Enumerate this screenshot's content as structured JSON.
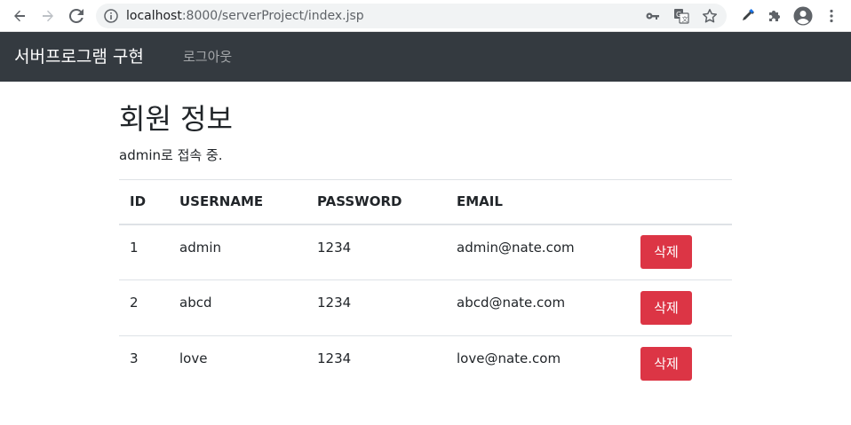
{
  "browser": {
    "url_host": "localhost",
    "url_rest": ":8000/serverProject/index.jsp"
  },
  "navbar": {
    "brand": "서버프로그램 구현",
    "logout": "로그아웃"
  },
  "main": {
    "title": "회원 정보",
    "status": "admin로 접속 중."
  },
  "table": {
    "headers": [
      "ID",
      "USERNAME",
      "PASSWORD",
      "EMAIL"
    ],
    "delete_label": "삭제",
    "rows": [
      {
        "id": "1",
        "username": "admin",
        "password": "1234",
        "email": "admin@nate.com"
      },
      {
        "id": "2",
        "username": "abcd",
        "password": "1234",
        "email": "abcd@nate.com"
      },
      {
        "id": "3",
        "username": "love",
        "password": "1234",
        "email": "love@nate.com"
      }
    ]
  },
  "colors": {
    "navbar_bg": "#343a40",
    "danger": "#dc3545"
  },
  "icons": [
    "back-icon",
    "forward-icon",
    "reload-icon",
    "info-icon",
    "key-icon",
    "translate-icon",
    "star-icon",
    "eyedropper-icon",
    "extensions-icon",
    "profile-icon",
    "menu-icon"
  ]
}
